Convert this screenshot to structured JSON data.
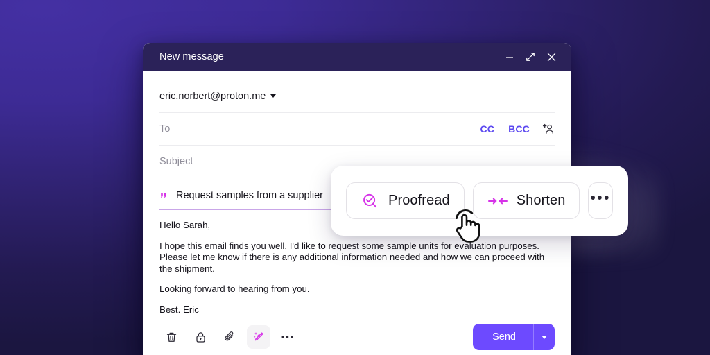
{
  "window": {
    "title": "New message",
    "controls": [
      {
        "name": "minimize",
        "icon": "minimize-icon"
      },
      {
        "name": "expand",
        "icon": "expand-icon"
      },
      {
        "name": "close",
        "icon": "close-icon"
      }
    ]
  },
  "compose": {
    "from_address": "eric.norbert@proton.me",
    "to_placeholder": "To",
    "subject_placeholder": "Subject",
    "cc_label": "CC",
    "bcc_label": "BCC",
    "add_contact_icon": "add-contact-icon",
    "prompt": {
      "icon": "quote-icon",
      "text": "Request samples from a supplier"
    },
    "body": {
      "greeting": "Hello Sarah,",
      "paragraph": "I hope this email finds you well. I'd like to request some sample units for evaluation purposes. Please let me know if there is any additional information needed and how we can proceed with the shipment.",
      "closing": "Looking forward to hearing from you.",
      "signature": "Best, Eric"
    }
  },
  "toolbar": {
    "items": [
      {
        "name": "delete-draft",
        "icon": "trash-icon",
        "active": false
      },
      {
        "name": "encryption",
        "icon": "lock-icon",
        "active": false
      },
      {
        "name": "attachment",
        "icon": "paperclip-icon",
        "active": false
      },
      {
        "name": "writing-assistant",
        "icon": "magic-wand-icon",
        "active": true
      }
    ],
    "more_label": "•••",
    "send_label": "Send"
  },
  "ai_popup": {
    "actions": [
      {
        "label": "Proofread",
        "icon": "proofread-check-magnifier-icon"
      },
      {
        "label": "Shorten",
        "icon": "shorten-arrows-icon"
      }
    ],
    "more_label": "•••"
  },
  "colors": {
    "titlebar": "#2b2259",
    "accent_violet": "#6d4aff",
    "link_violet": "#5c49f0",
    "ai_magenta": "#d633e8",
    "prompt_underline": "#c9a6e8",
    "background_purple": "#3d2b95"
  }
}
